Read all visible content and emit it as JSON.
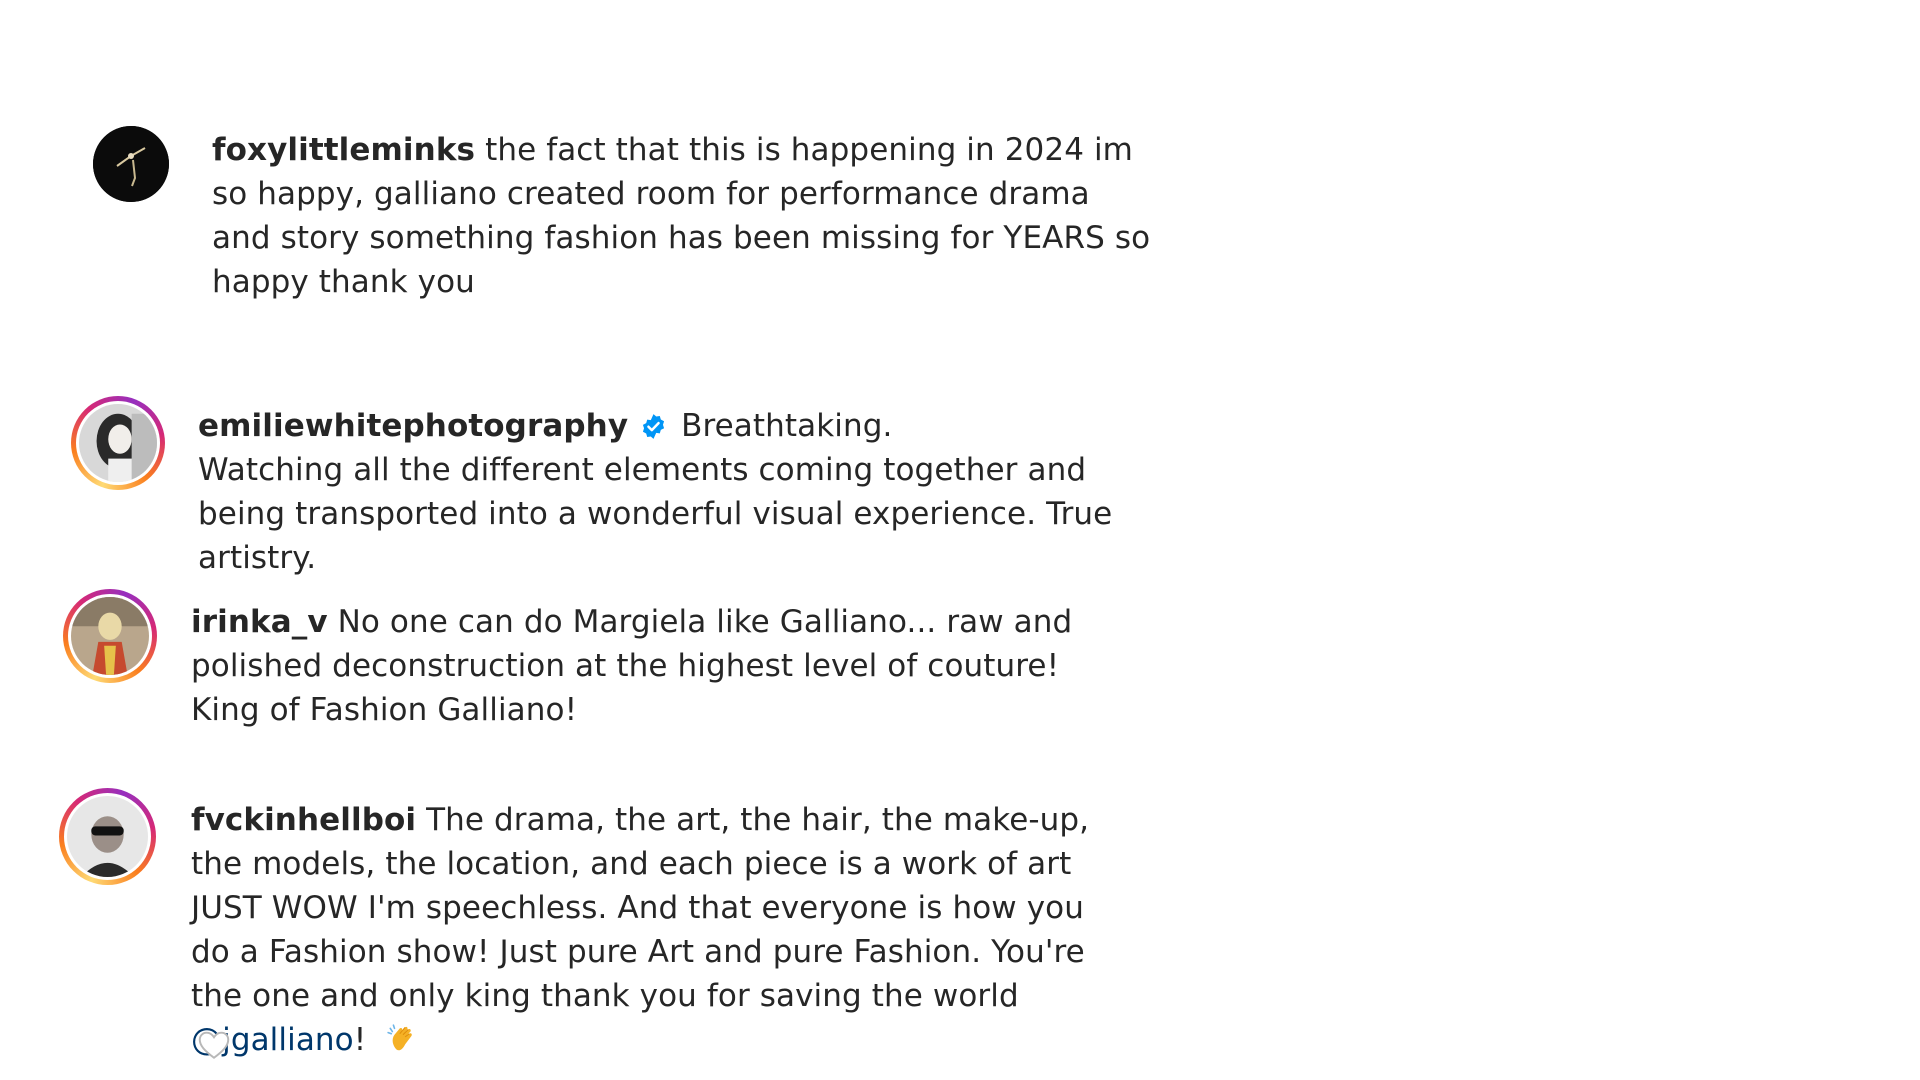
{
  "comments": [
    {
      "username": "foxylittleminks",
      "text": "the fact that this is happening in 2024 im so happy, galliano created room for performance drama and story something fashion has been missing for YEARS so happy thank you",
      "avatar_icon": "dark-photo-avatar",
      "has_story_ring": false
    },
    {
      "username": "emiliewhitephotography",
      "verified": true,
      "text_line1": "Breathtaking.",
      "text": "Watching all the different elements coming together and being transported into a wonderful visual experience. True artistry.",
      "avatar_icon": "portrait-avatar",
      "has_story_ring": true
    },
    {
      "username": "irinka_v",
      "text": "No one can do Margiela like Galliano... raw and polished deconstruction at the highest level of couture! King of Fashion Galliano!",
      "avatar_icon": "portrait-avatar",
      "has_story_ring": true
    },
    {
      "username": "fvckinhellboi",
      "text": "The drama, the art, the hair, the make-up, the models, the location, and each piece is a work of art JUST WOW I'm speechless. And that everyone is how you do a Fashion show! Just pure Art and pure Fashion. You're the one and only king thank you for saving the world",
      "mention": "@jgalliano",
      "after_mention": "!",
      "emoji": "clapping-hands",
      "avatar_icon": "portrait-avatar",
      "has_story_ring": true
    }
  ],
  "colors": {
    "text": "#262626",
    "mention": "#00376b",
    "verified": "#0095f6",
    "background": "#ffffff"
  },
  "icons": [
    "verified-badge-icon",
    "clapping-hands-emoji",
    "heart-icon"
  ]
}
